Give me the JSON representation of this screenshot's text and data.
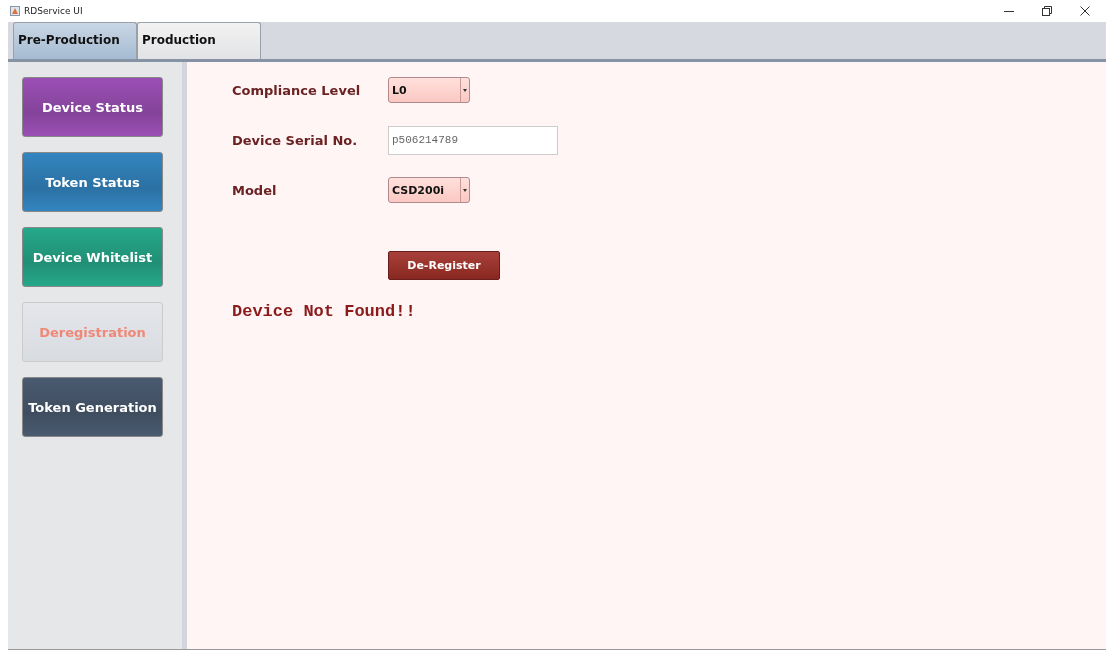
{
  "window": {
    "title": "RDService UI"
  },
  "tabs": [
    {
      "label": "Pre-Production",
      "selected": true
    },
    {
      "label": "Production",
      "selected": false
    }
  ],
  "sidebar": {
    "items": [
      {
        "label": "Device Status",
        "color": "#9b4fb5",
        "selected": false
      },
      {
        "label": "Token Status",
        "color": "#3385c0",
        "selected": false
      },
      {
        "label": "Device Whitelist",
        "color": "#26a88a",
        "selected": false
      },
      {
        "label": "Deregistration",
        "color": "#f08878",
        "selected": true
      },
      {
        "label": "Token Generation",
        "color": "#4a5a70",
        "selected": false
      }
    ]
  },
  "form": {
    "fields": [
      {
        "kind": "dropdown",
        "label": "Compliance Level",
        "value": "L0"
      },
      {
        "kind": "text",
        "label": "Device Serial No.",
        "value": "p506214789"
      },
      {
        "kind": "dropdown",
        "label": "Model",
        "value": "CSD200i"
      }
    ],
    "button": "De-Register",
    "message": "Device Not Found!!"
  }
}
